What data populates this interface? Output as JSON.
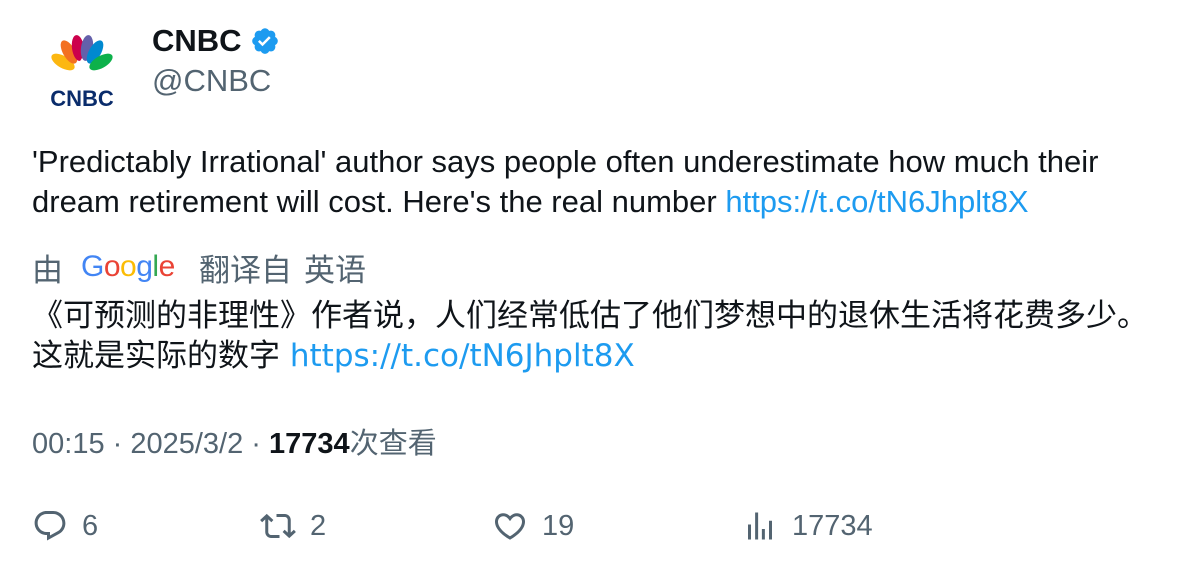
{
  "account": {
    "name": "CNBC",
    "handle": "@CNBC",
    "verified_icon": "verified-badge-icon",
    "avatar_text": "CNBC",
    "avatar_icon": "nbc-peacock-logo"
  },
  "tweet": {
    "text": "'Predictably Irrational' author says people often underestimate how much their dream retirement will cost. Here's the real number ",
    "link": "https://t.co/tN6Jhplt8X"
  },
  "translation": {
    "by": "由",
    "service_logo": "google-logo",
    "translated_from": "翻译自",
    "language": "英语",
    "text": "《可预测的非理性》作者说，人们经常低估了他们梦想中的退休生活将花费多少。这就是实际的数字 ",
    "link": "https://t.co/tN6Jhplt8X"
  },
  "meta": {
    "time": "00:15",
    "separator": " · ",
    "date": "2025/3/2",
    "views_count": "17734",
    "views_label": "次查看"
  },
  "actions": {
    "replies": "6",
    "retweets": "2",
    "likes": "19",
    "views": "17734"
  },
  "colors": {
    "link": "#1d9bf0",
    "secondary_text": "#536471",
    "primary_text": "#0f1419"
  }
}
